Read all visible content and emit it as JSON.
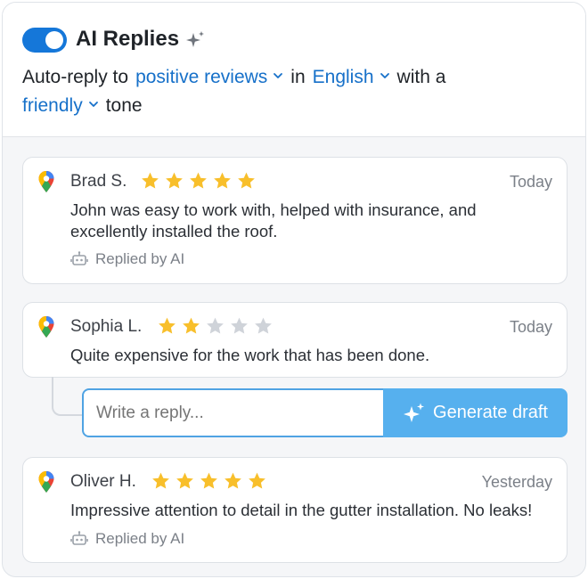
{
  "header": {
    "toggle_state": "on",
    "title": "AI Replies",
    "title_icon": "sparkle-icon",
    "prefix": "Auto-reply to",
    "review_filter": "positive reviews",
    "in_word": "in",
    "language": "English",
    "with_word": "with a",
    "tone": "friendly",
    "tone_word": "tone"
  },
  "colors": {
    "accent": "#1577d9",
    "link": "#1670c9",
    "star_filled": "#f8bf2b",
    "star_empty": "#cfd3d9",
    "button": "#56b0ee"
  },
  "reviews": [
    {
      "name": "Brad S.",
      "rating": 5,
      "date": "Today",
      "text": "John was easy to work with, helped with insurance, and excellently installed the roof.",
      "status": "Replied by AI"
    },
    {
      "name": "Sophia L.",
      "rating": 2,
      "date": "Today",
      "text": "Quite expensive for the work that has been done."
    },
    {
      "name": "Oliver H.",
      "rating": 5,
      "date": "Yesterday",
      "text": "Impressive attention to detail in the gutter installation. No leaks!",
      "status": "Replied by AI"
    }
  ],
  "reply": {
    "placeholder": "Write a reply...",
    "button_label": "Generate draft"
  }
}
